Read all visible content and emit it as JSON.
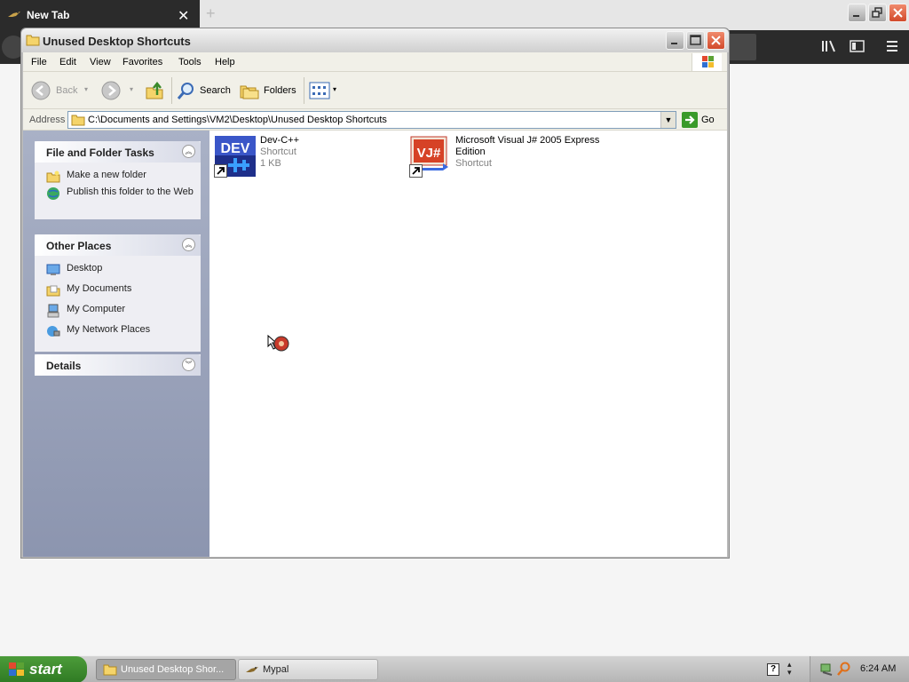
{
  "browser": {
    "tab_title": "New Tab",
    "tab_close": "✕",
    "new_tab": "+",
    "colors": {
      "toolbar": "#2b2b2b",
      "tabbar": "#e6e6e6"
    }
  },
  "window": {
    "title": "Unused Desktop Shortcuts",
    "menu": [
      "File",
      "Edit",
      "View",
      "Favorites",
      "Tools",
      "Help"
    ],
    "toolbar": {
      "back": "Back",
      "search": "Search",
      "folders": "Folders"
    },
    "address": {
      "label": "Address",
      "value": "C:\\Documents and Settings\\VM2\\Desktop\\Unused Desktop Shortcuts",
      "go": "Go"
    }
  },
  "taskpane": {
    "sections": [
      {
        "title": "File and Folder Tasks",
        "chevron": "up",
        "items": [
          {
            "label": "Make a new folder",
            "icon": "new-folder-icon"
          },
          {
            "label": "Publish this folder to the Web",
            "icon": "publish-web-icon"
          }
        ]
      },
      {
        "title": "Other Places",
        "chevron": "up",
        "items": [
          {
            "label": "Desktop",
            "icon": "desktop-icon"
          },
          {
            "label": "My Documents",
            "icon": "my-documents-icon"
          },
          {
            "label": "My Computer",
            "icon": "my-computer-icon"
          },
          {
            "label": "My Network Places",
            "icon": "network-places-icon"
          }
        ]
      },
      {
        "title": "Details",
        "chevron": "down",
        "items": []
      }
    ]
  },
  "files": [
    {
      "name": "Dev-C++",
      "type": "Shortcut",
      "size": "1 KB",
      "icon_text": "DEV",
      "icon": "dev-cpp-icon"
    },
    {
      "name": "Microsoft Visual J# 2005 Express Edition",
      "type": "Shortcut",
      "icon_text": "VJ#",
      "icon": "visual-jsharp-icon"
    }
  ],
  "taskbar": {
    "start": "start",
    "tasks": [
      {
        "label": "Unused Desktop Shor...",
        "active": true
      },
      {
        "label": "Mypal",
        "active": false
      }
    ],
    "clock": "6:24 AM"
  }
}
